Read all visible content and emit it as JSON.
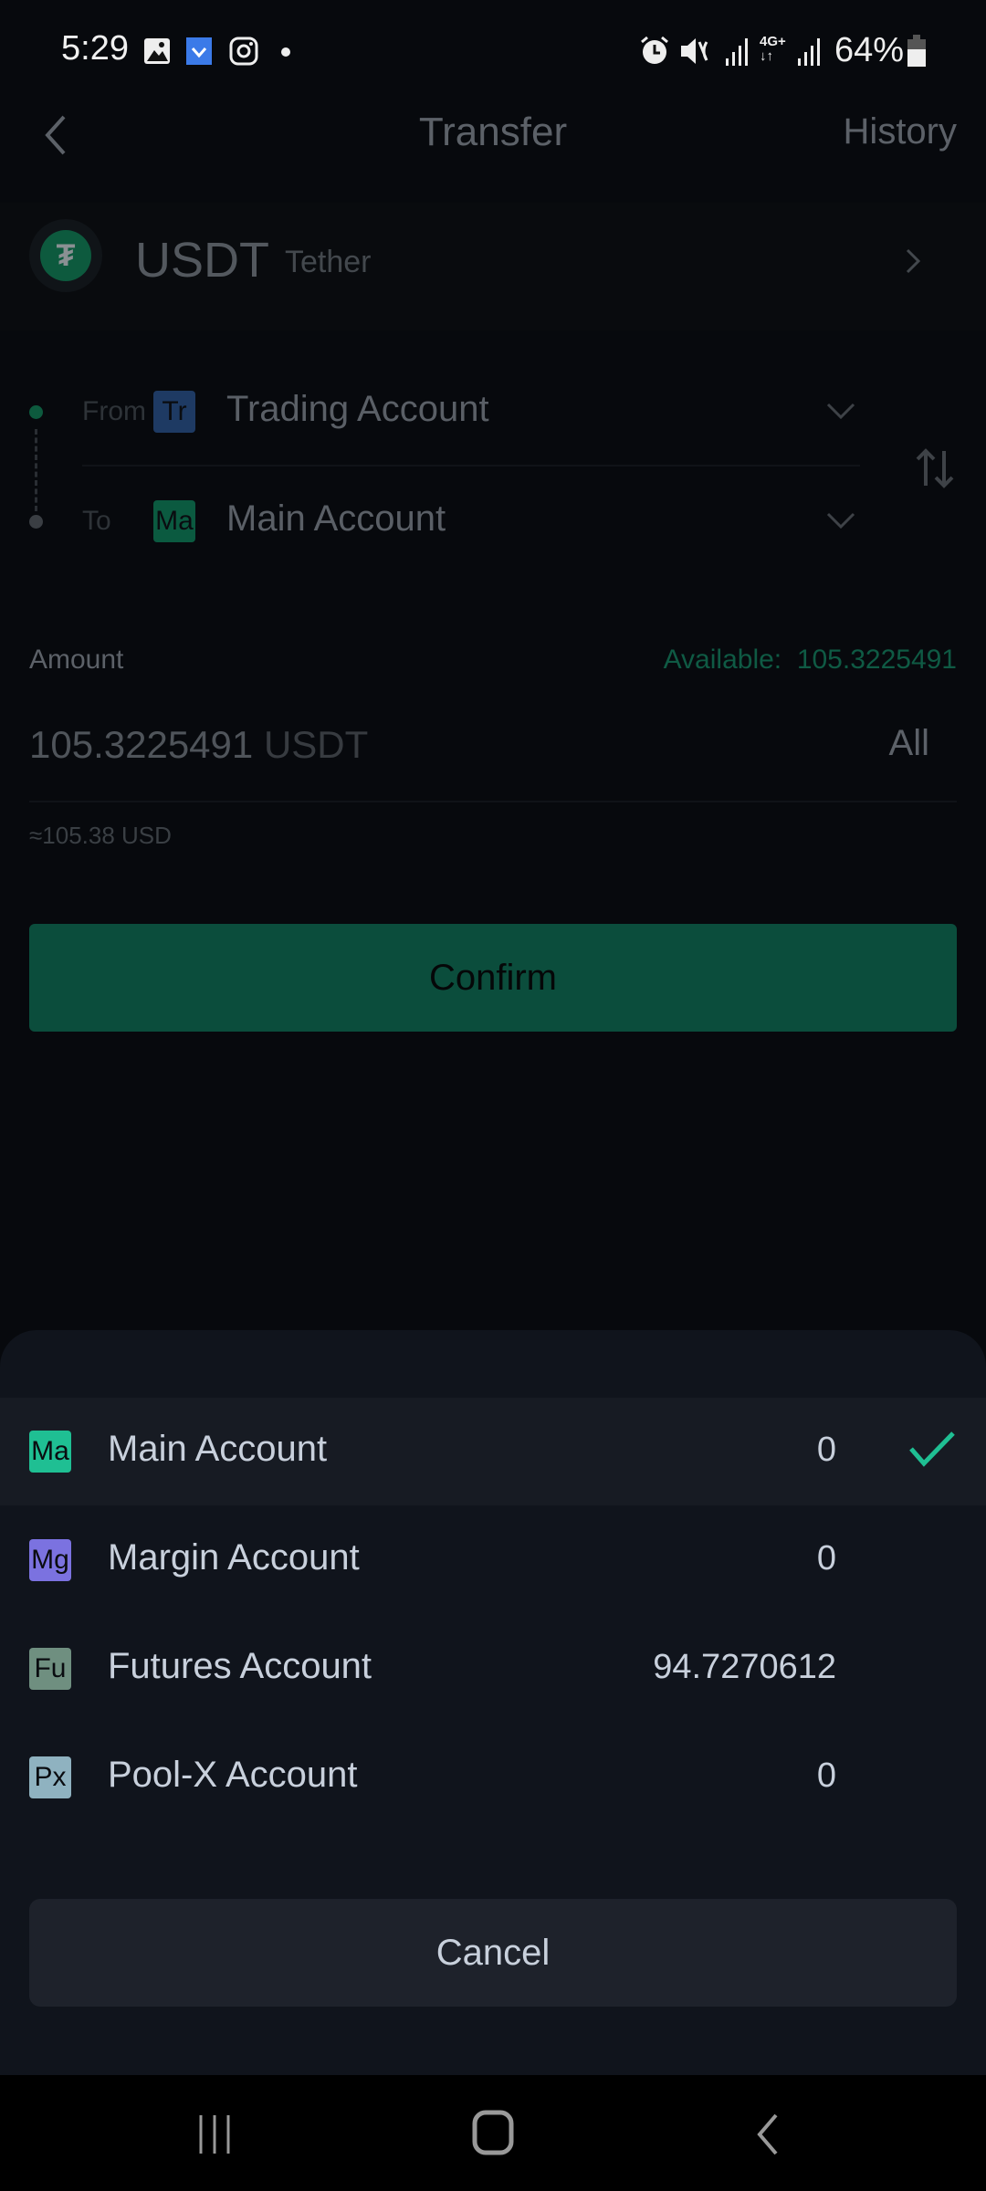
{
  "status_bar": {
    "time": "5:29",
    "left_icons": [
      "gallery-icon",
      "app-notification-icon",
      "instagram-icon",
      "more-dot-icon"
    ],
    "right_icons": [
      "alarm-icon",
      "mute-icon",
      "signal-icon",
      "4g-plus-icon",
      "signal-icon"
    ],
    "network": "4G+",
    "battery": "64%"
  },
  "header": {
    "title": "Transfer",
    "history_label": "History"
  },
  "coin": {
    "symbol": "USDT",
    "name": "Tether",
    "icon_glyph": "₮"
  },
  "transfer": {
    "from_label": "From",
    "from_badge": "Tr",
    "from_account": "Trading Account",
    "to_label": "To",
    "to_badge": "Ma",
    "to_account": "Main Account"
  },
  "amount": {
    "label": "Amount",
    "available_label": "Available:",
    "available_value": "105.3225491",
    "value": "105.3225491",
    "currency": "USDT",
    "all_label": "All",
    "approx_usd": "≈105.38 USD"
  },
  "confirm_label": "Confirm",
  "sheet": {
    "options": [
      {
        "badge": "Ma",
        "name": "Main Account",
        "balance": "0",
        "selected": true,
        "color": "#1fbf93"
      },
      {
        "badge": "Mg",
        "name": "Margin Account",
        "balance": "0",
        "selected": false,
        "color": "#7b72e0"
      },
      {
        "badge": "Fu",
        "name": "Futures Account",
        "balance": "94.7270612",
        "selected": false,
        "color": "#6f8f80"
      },
      {
        "badge": "Px",
        "name": "Pool-X Account",
        "balance": "0",
        "selected": false,
        "color": "#8fb2c0"
      }
    ],
    "cancel_label": "Cancel"
  },
  "colors": {
    "accent_green": "#1fbf93",
    "confirm_bg_dimmed": "#0b4d3c",
    "sheet_bg": "#10141c"
  }
}
